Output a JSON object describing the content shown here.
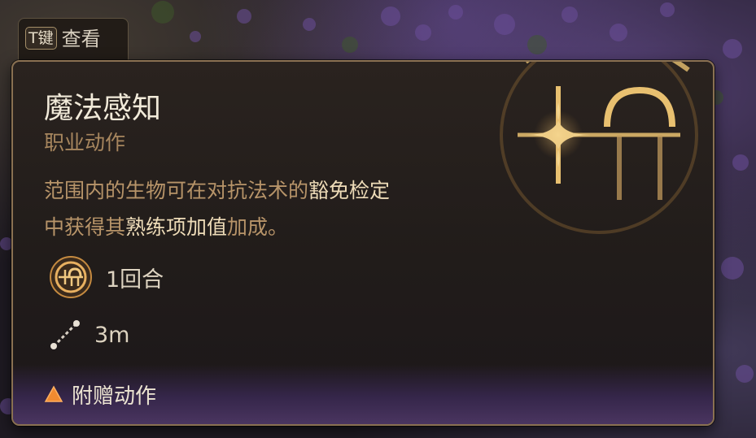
{
  "hint": {
    "key": "T键",
    "label": "查看"
  },
  "tooltip": {
    "title": "魔法感知",
    "subtitle": "职业动作",
    "description": [
      {
        "text": "范围内的生物可在对抗法术的",
        "highlight": false
      },
      {
        "text": "豁免检定",
        "highlight": true
      },
      {
        "text": "中获得其",
        "highlight": false
      },
      {
        "text": "熟练项加值",
        "highlight": true
      },
      {
        "text": "加成。",
        "highlight": false
      }
    ],
    "cost": {
      "icon": "action-emblem-icon",
      "text": "1回合"
    },
    "range": {
      "icon": "ruler-icon",
      "text": "3m"
    },
    "footer": {
      "icon": "bonus-action-triangle-icon",
      "text": "附赠动作"
    }
  },
  "colors": {
    "accent_gold": "#e8c070",
    "border": "#8a7152",
    "subtitle": "#a7865e",
    "footer_purple": "#4a3560",
    "triangle": "#f08a30"
  }
}
